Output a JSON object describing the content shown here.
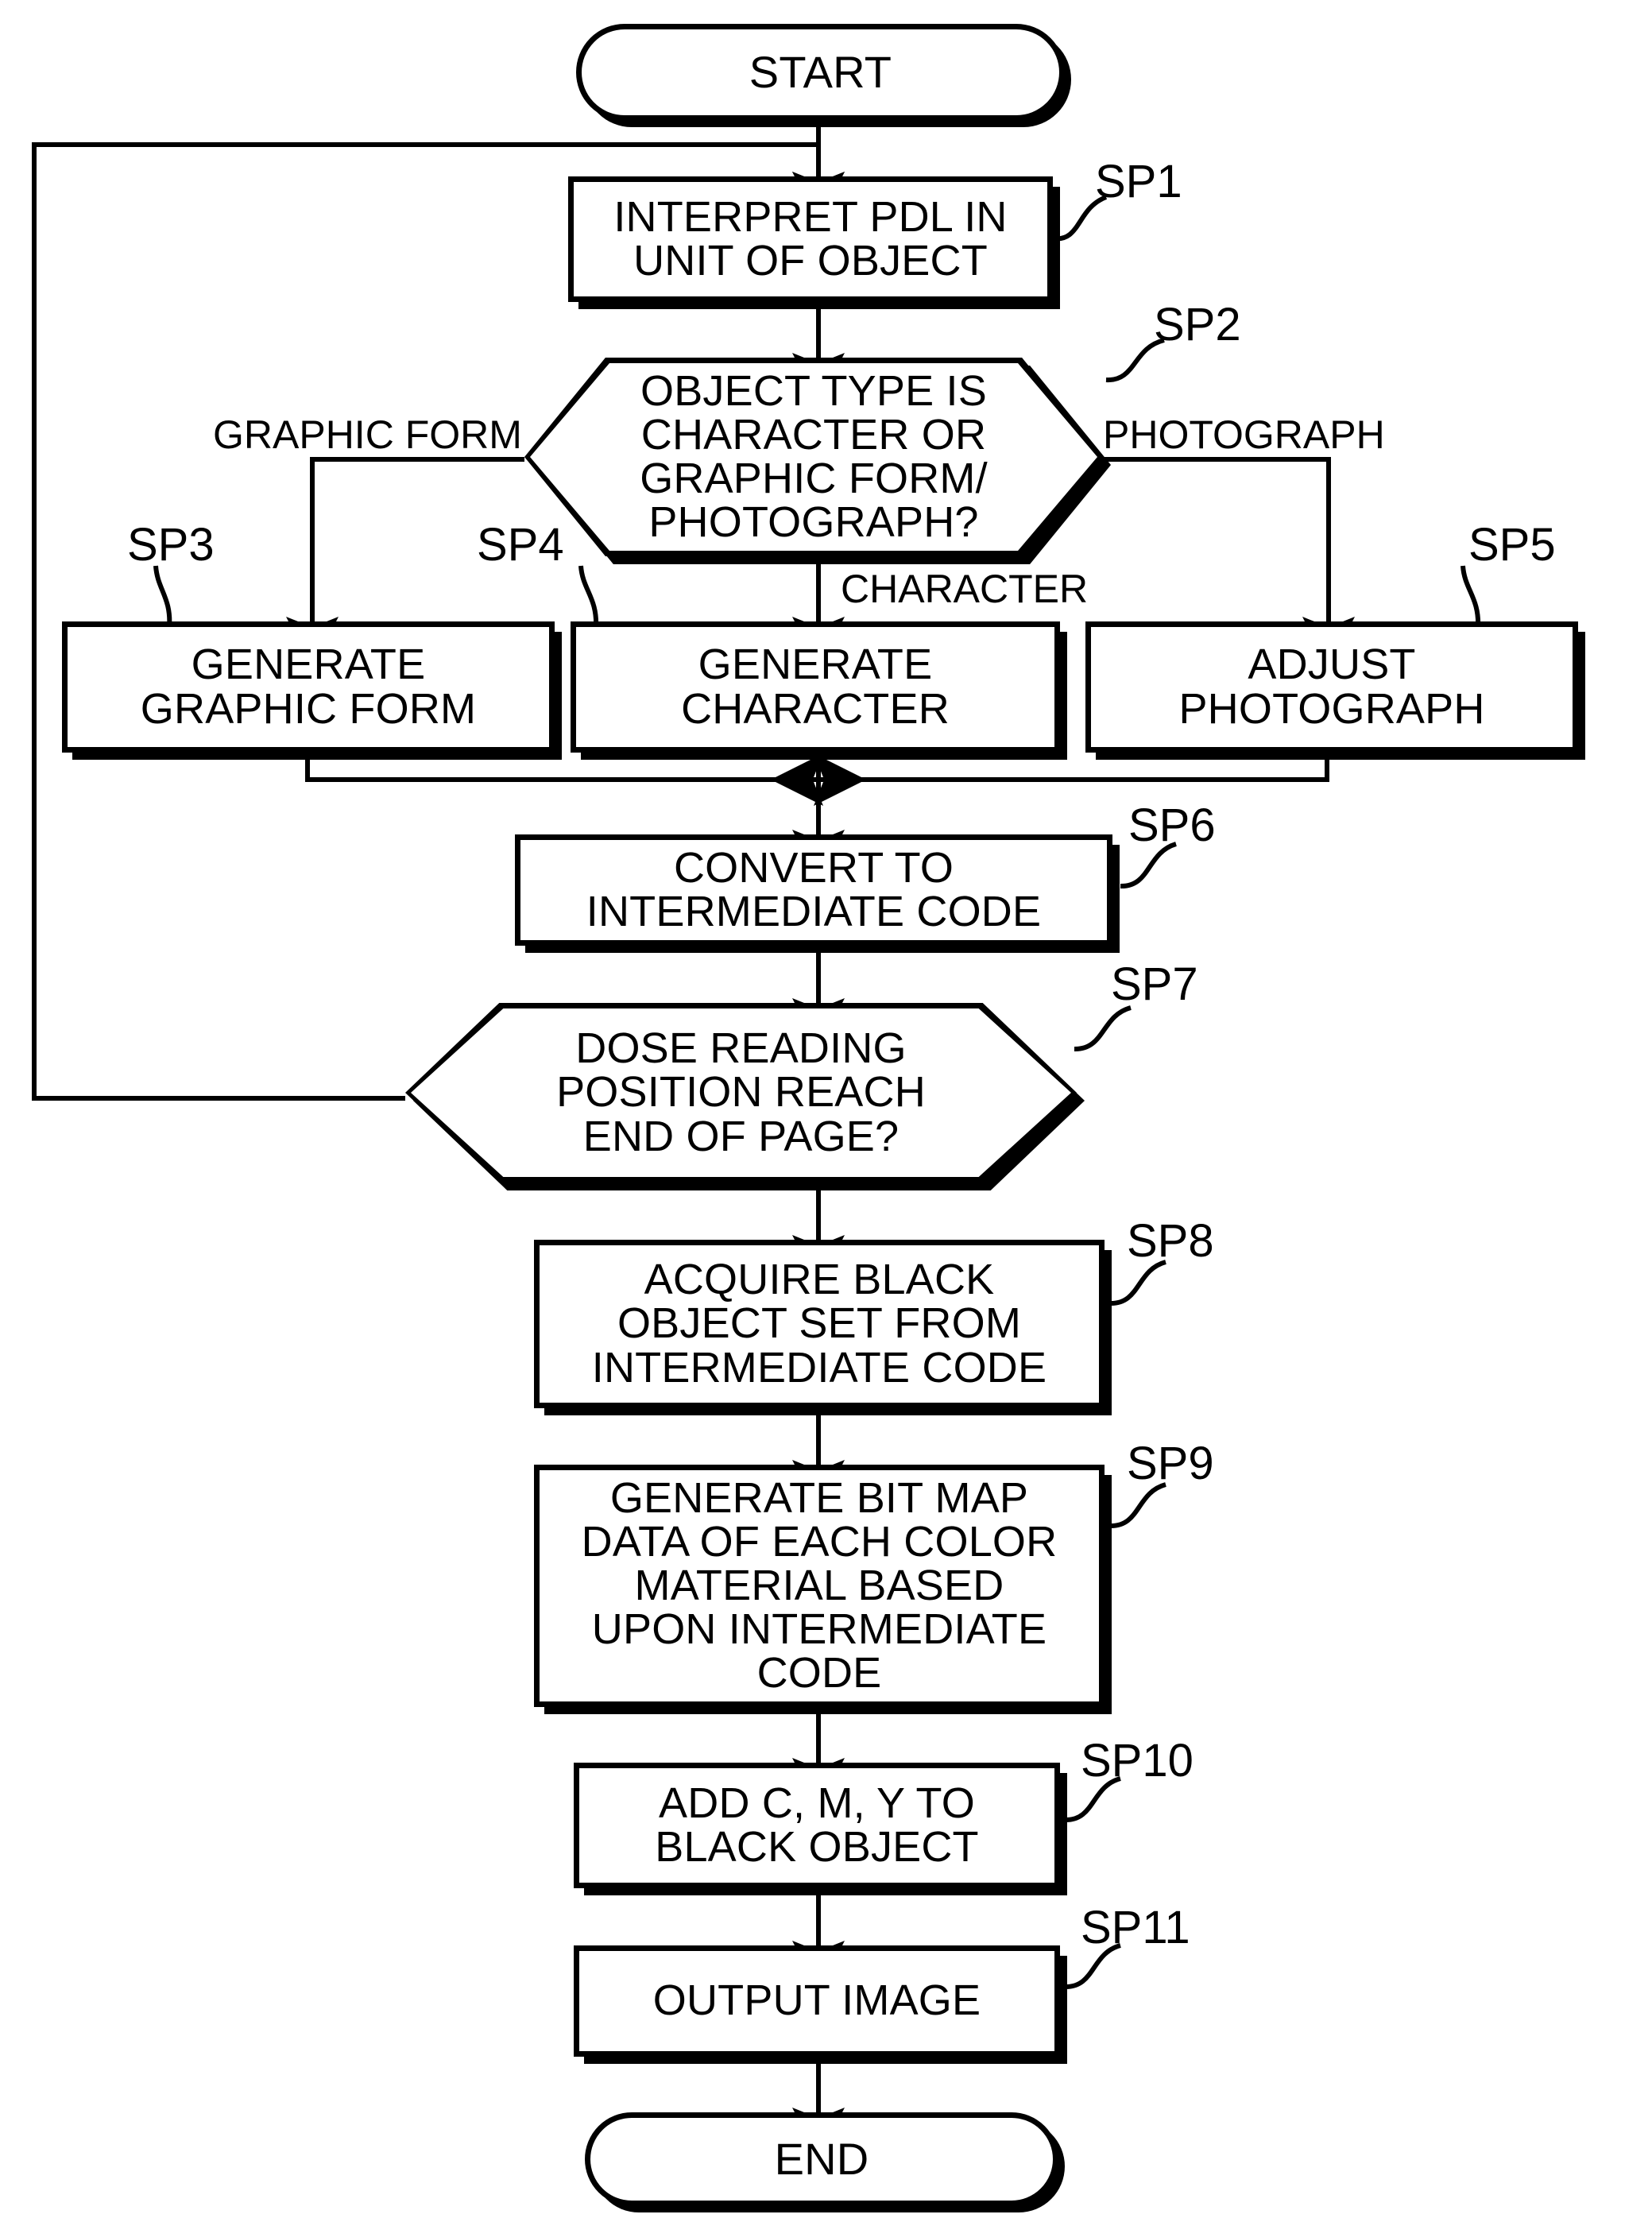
{
  "figure": {
    "type": "flowchart",
    "orientation": "vertical",
    "line_color": "#000000",
    "background_color": "#ffffff"
  },
  "nodes": {
    "start": {
      "label": "START",
      "shape": "terminator"
    },
    "sp1": {
      "label": "INTERPRET PDL IN\nUNIT OF OBJECT",
      "shape": "process",
      "tag": "SP1"
    },
    "sp2": {
      "label": "OBJECT TYPE IS\nCHARACTER OR\nGRAPHIC FORM/\nPHOTOGRAPH?",
      "shape": "decision",
      "tag": "SP2"
    },
    "sp3": {
      "label": "GENERATE\nGRAPHIC FORM",
      "shape": "process",
      "tag": "SP3"
    },
    "sp4": {
      "label": "GENERATE\nCHARACTER",
      "shape": "process",
      "tag": "SP4"
    },
    "sp5": {
      "label": "ADJUST\nPHOTOGRAPH",
      "shape": "process",
      "tag": "SP5"
    },
    "sp6": {
      "label": "CONVERT TO\nINTERMEDIATE CODE",
      "shape": "process",
      "tag": "SP6"
    },
    "sp7": {
      "label": "DOSE READING\nPOSITION REACH\nEND OF PAGE?",
      "shape": "decision",
      "tag": "SP7"
    },
    "sp8": {
      "label": "ACQUIRE BLACK\nOBJECT SET FROM\nINTERMEDIATE CODE",
      "shape": "process",
      "tag": "SP8"
    },
    "sp9": {
      "label": "GENERATE BIT MAP\nDATA OF EACH COLOR\nMATERIAL BASED\nUPON INTERMEDIATE\nCODE",
      "shape": "process",
      "tag": "SP9"
    },
    "sp10": {
      "label": "ADD C, M, Y TO\nBLACK OBJECT",
      "shape": "process",
      "tag": "SP10"
    },
    "sp11": {
      "label": "OUTPUT IMAGE",
      "shape": "process",
      "tag": "SP11"
    },
    "end": {
      "label": "END",
      "shape": "terminator"
    }
  },
  "edge_labels": {
    "graphic_form": "GRAPHIC FORM",
    "photograph": "PHOTOGRAPH",
    "character": "CHARACTER"
  },
  "step_tags": {
    "sp1": "SP1",
    "sp2": "SP2",
    "sp3": "SP3",
    "sp4": "SP4",
    "sp5": "SP5",
    "sp6": "SP6",
    "sp7": "SP7",
    "sp8": "SP8",
    "sp9": "SP9",
    "sp10": "SP10",
    "sp11": "SP11"
  }
}
